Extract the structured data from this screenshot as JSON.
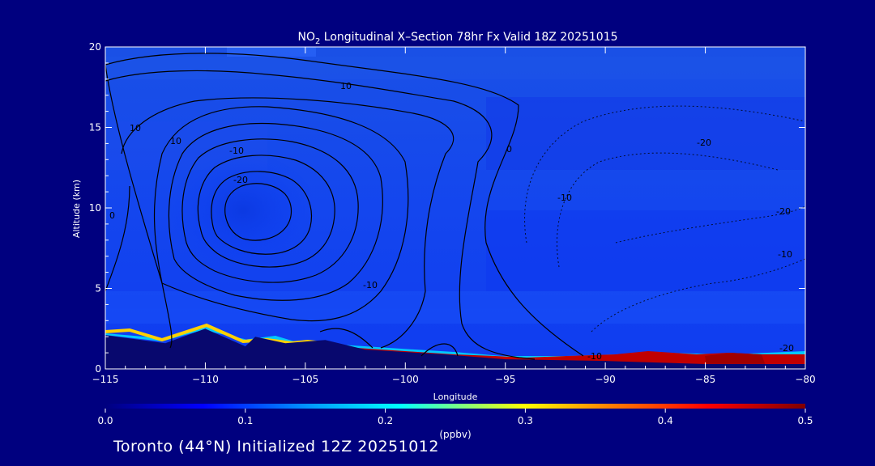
{
  "colors": {
    "background": "#00007f",
    "field_low": "#0a3cff",
    "field_high": "#a00000",
    "contour": "#000000",
    "axis": "#ffffff"
  },
  "footer": "Toronto (44°N) Initialized 12Z 20251012",
  "chart_data": {
    "type": "heatmap",
    "title": {
      "prefix": "NO",
      "subscript": "2",
      "suffix": " Longitudinal X–Section 78hr  Fx Valid 18Z 20251015"
    },
    "xlabel": "Longitude",
    "ylabel": "Altitude (km)",
    "xlim": [
      -115,
      -80
    ],
    "ylim": [
      0,
      20
    ],
    "x_ticks": [
      -115,
      -110,
      -105,
      -100,
      -95,
      -90,
      -85,
      -80
    ],
    "x_tick_labels": [
      "−115",
      "−110",
      "−105",
      "−100",
      "−95",
      "−90",
      "−85",
      "−80"
    ],
    "y_ticks": [
      0,
      5,
      10,
      15,
      20
    ],
    "y_tick_labels": [
      "0",
      "5",
      "10",
      "15",
      "20"
    ],
    "colorbar": {
      "label": "(ppbv)",
      "range": [
        0.0,
        0.5
      ],
      "ticks": [
        "0.0",
        "0.1",
        "0.2",
        "0.3",
        "0.4",
        "0.5"
      ],
      "colors": [
        "#00007f",
        "#0000ff",
        "#00a0ff",
        "#00ffff",
        "#ffff00",
        "#ff8000",
        "#ff0000",
        "#7f0000"
      ]
    },
    "terrain_km": [
      [
        -115,
        2.1
      ],
      [
        -112,
        1.6
      ],
      [
        -110,
        2.5
      ],
      [
        -108,
        1.4
      ],
      [
        -107.5,
        2.0
      ],
      [
        -106,
        1.6
      ],
      [
        -104,
        1.8
      ],
      [
        -102,
        1.2
      ],
      [
        -98,
        0.9
      ],
      [
        -95,
        0.6
      ],
      [
        -90,
        0.5
      ],
      [
        -85,
        0.3
      ],
      [
        -80,
        0.3
      ]
    ],
    "surface_layer_no2": [
      {
        "x": [
          -115,
          -105
        ],
        "value": 0.3
      },
      {
        "x": [
          -104,
          -97
        ],
        "value": 0.45
      },
      {
        "x": [
          -97,
          -91
        ],
        "value": 0.35
      },
      {
        "x": [
          -91,
          -80
        ],
        "value": 0.45
      }
    ],
    "contour_labels": [
      "10",
      "10",
      "0",
      "10",
      "-20",
      "-10",
      "-20",
      "-10",
      "0",
      "-10",
      "-20",
      "-10",
      "-20",
      "-10"
    ]
  }
}
